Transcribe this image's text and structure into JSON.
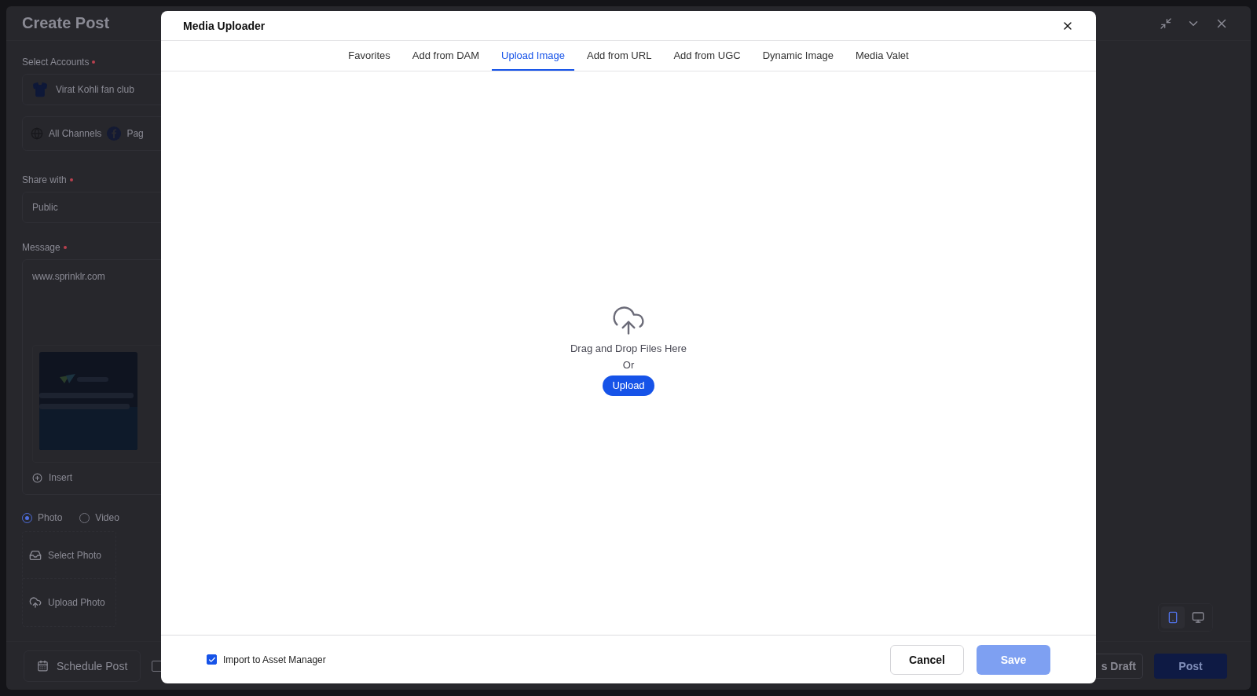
{
  "background": {
    "title": "Create Post",
    "select_accounts": {
      "label": "Select Accounts",
      "required": true,
      "account": "Virat Kohli fan club"
    },
    "channels": [
      {
        "kind": "all",
        "label": "All Channels"
      },
      {
        "kind": "facebook",
        "label": "Pag"
      }
    ],
    "share_with": {
      "label": "Share with",
      "required": true,
      "value": "Public"
    },
    "message": {
      "label": "Message",
      "required": true,
      "value": "www.sprinklr.com",
      "insert": "Insert"
    },
    "media_type": [
      {
        "label": "Photo",
        "selected": true
      },
      {
        "label": "Video",
        "selected": false
      }
    ],
    "media_actions": [
      {
        "kind": "select",
        "label": "Select Photo"
      },
      {
        "kind": "upload",
        "label": "Upload Photo"
      }
    ],
    "schedule_button": "Schedule Post",
    "schedule_checkbox": {
      "checked": false
    },
    "preview_devices": [
      {
        "kind": "mobile",
        "selected": true
      },
      {
        "kind": "desktop",
        "selected": false
      }
    ],
    "draft_button": "s Draft",
    "post_button": "Post"
  },
  "modal": {
    "title": "Media Uploader",
    "tabs": [
      {
        "label": "Favorites",
        "selected": false
      },
      {
        "label": "Add from DAM",
        "selected": false
      },
      {
        "label": "Upload Image",
        "selected": true
      },
      {
        "label": "Add from URL",
        "selected": false
      },
      {
        "label": "Add from UGC",
        "selected": false
      },
      {
        "label": "Dynamic Image",
        "selected": false
      },
      {
        "label": "Media Valet",
        "selected": false
      }
    ],
    "dropzone": {
      "text": "Drag and Drop Files Here",
      "separator": "Or",
      "button": "Upload"
    },
    "import_checkbox": {
      "label": "Import to Asset Manager",
      "checked": true
    },
    "cancel_button": "Cancel",
    "save_button": {
      "label": "Save",
      "disabled": true
    }
  }
}
